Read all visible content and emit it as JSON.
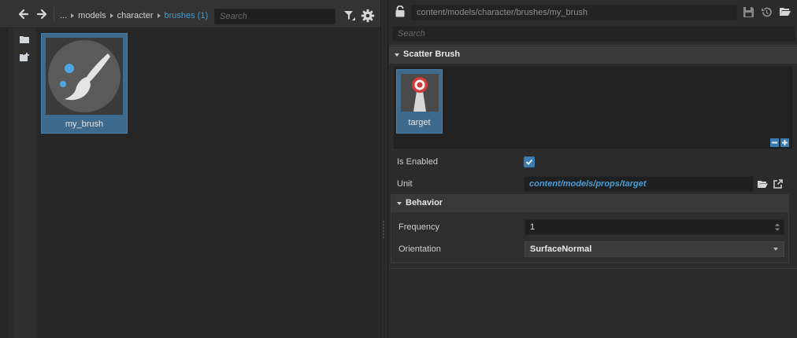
{
  "asset_browser": {
    "breadcrumb": {
      "ellipsis": "...",
      "items": [
        "models",
        "character"
      ],
      "active": "brushes (1)"
    },
    "search_placeholder": "Search",
    "assets": [
      {
        "name": "my_brush"
      }
    ]
  },
  "property_editor": {
    "path": "content/models/character/brushes/my_brush",
    "search_placeholder": "Search",
    "scatter_section": {
      "title": "Scatter Brush",
      "units": [
        {
          "name": "target"
        }
      ]
    },
    "properties": {
      "is_enabled": {
        "label": "Is Enabled",
        "checked": true
      },
      "unit": {
        "label": "Unit",
        "value": "content/models/props/target"
      }
    },
    "behavior_section": {
      "title": "Behavior",
      "frequency": {
        "label": "Frequency",
        "value": "1"
      },
      "orientation": {
        "label": "Orientation",
        "value": "SurfaceNormal"
      }
    }
  },
  "colors": {
    "accent": "#3b9cd9",
    "selection": "#3d6a8d",
    "background": "#2b2b2b"
  }
}
